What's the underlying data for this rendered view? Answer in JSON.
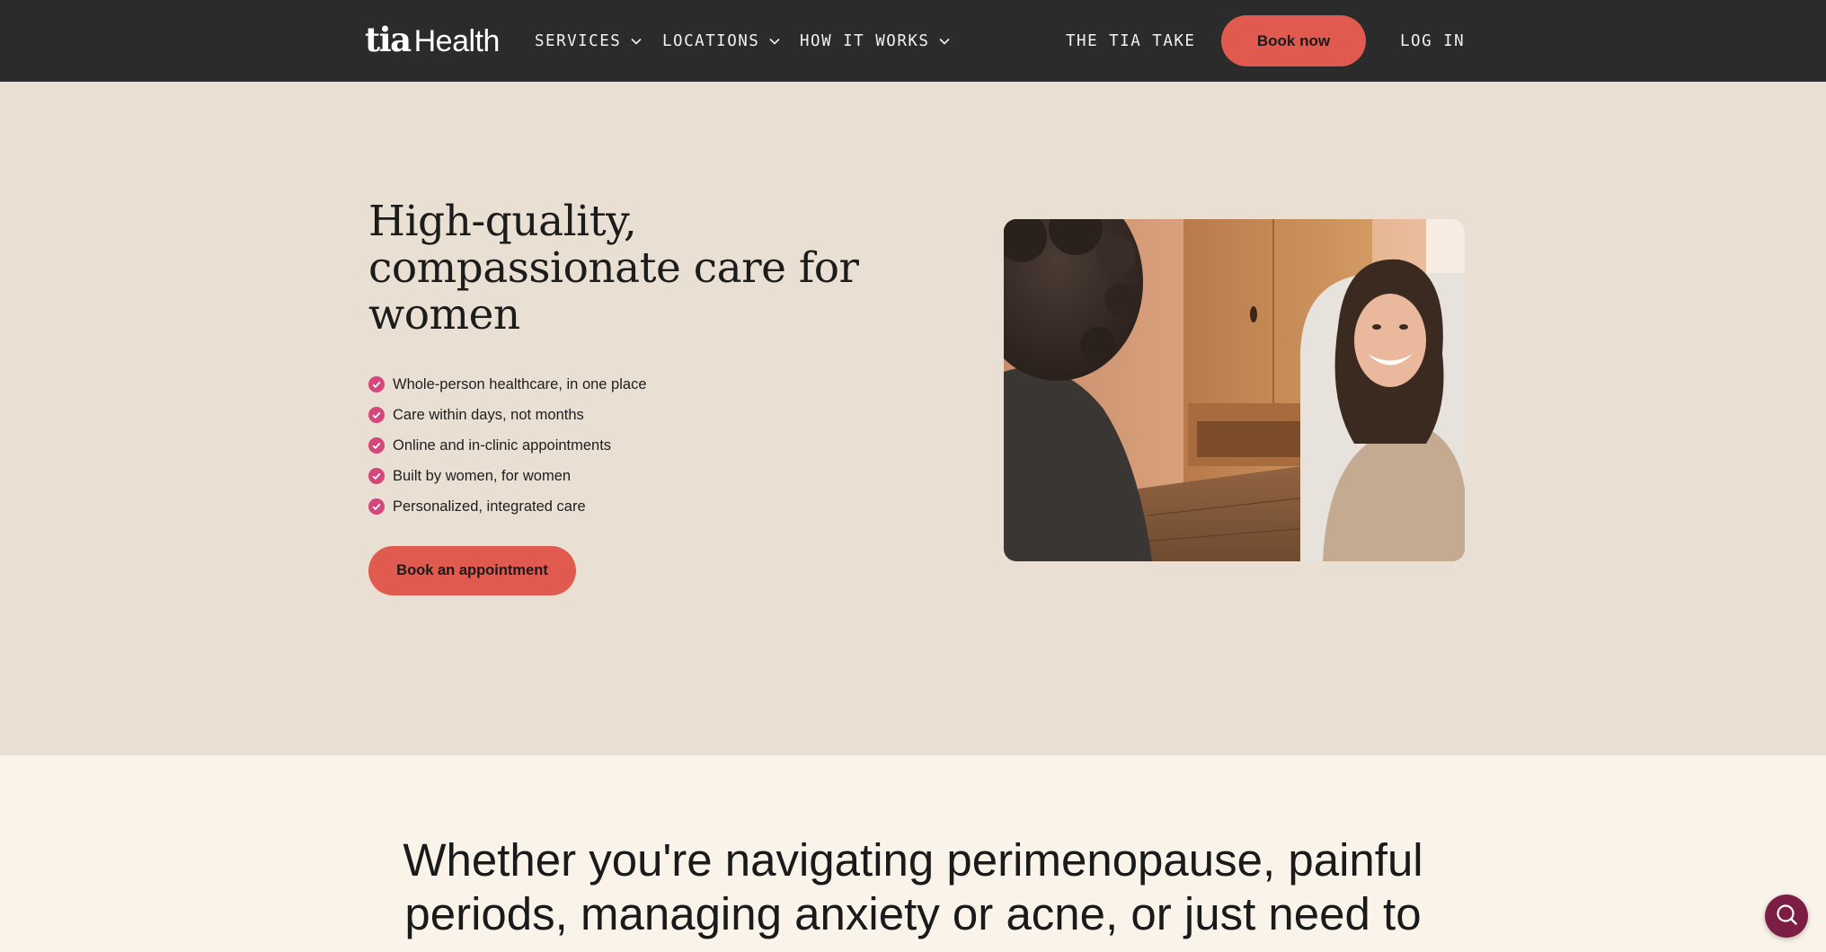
{
  "nav": {
    "logo_tia": "tia",
    "logo_health": "Health",
    "services": "SERVICES",
    "locations": "LOCATIONS",
    "how_it_works": "HOW IT WORKS",
    "tia_take": "THE TIA TAKE",
    "book_now": "Book now",
    "log_in": "LOG IN"
  },
  "hero": {
    "title": "High-quality, compassionate care for women",
    "features": [
      "Whole-person healthcare, in one place",
      "Care within days, not months",
      "Online and in-clinic appointments",
      "Built by women, for women",
      "Personalized, integrated care"
    ],
    "cta": "Book an appointment"
  },
  "intro": {
    "line1": "Whether you're navigating perimenopause, painful",
    "line2": "periods, managing anxiety or acne, or just need to"
  },
  "colors": {
    "nav_bg": "#2b2b2b",
    "accent": "#e05a4f",
    "check": "#d3477b",
    "hero_bg": "#e9dfd3",
    "page_bg": "#faf3ea",
    "chat": "#7b1d45"
  },
  "icons": {
    "dropdown": "chevron-down-icon",
    "feature": "check-circle-icon",
    "chat": "chat-search-icon"
  }
}
